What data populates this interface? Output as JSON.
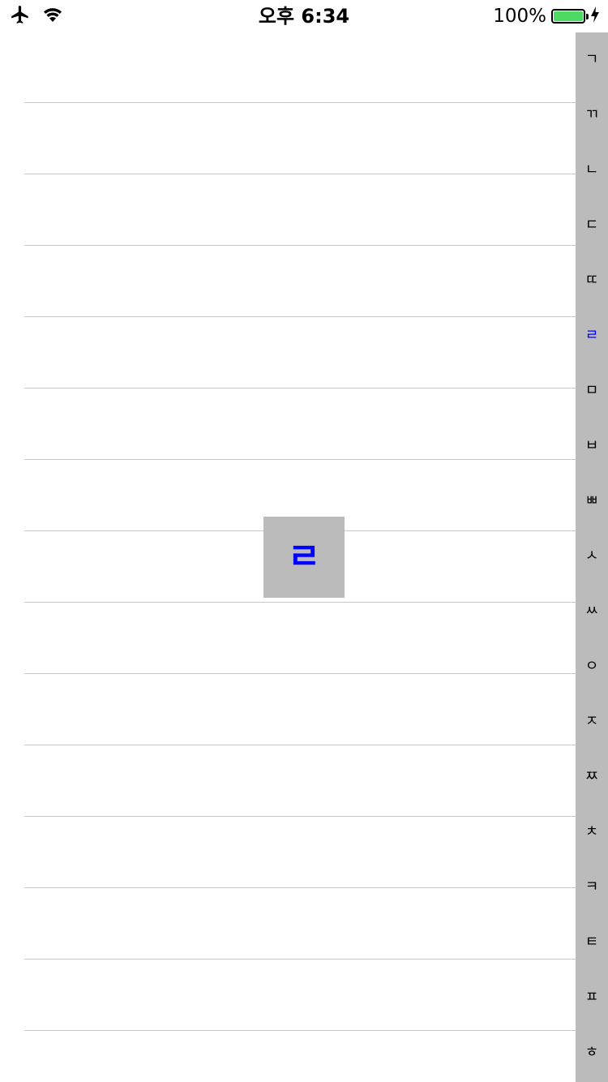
{
  "status_bar": {
    "time": "오후 6:34",
    "battery_percent": "100%",
    "battery_level": 1.0,
    "battery_color": "#4cd964",
    "icons": [
      "airplane-icon",
      "wifi-icon",
      "charging-bolt-icon"
    ]
  },
  "table": {
    "row_count": 15
  },
  "index": {
    "highlight_color": "#0000ff",
    "selected": "ㄹ",
    "letters": [
      "ㄱ",
      "ㄲ",
      "ㄴ",
      "ㄷ",
      "ㄸ",
      "ㄹ",
      "ㅁ",
      "ㅂ",
      "ㅃ",
      "ㅅ",
      "ㅆ",
      "ㅇ",
      "ㅈ",
      "ㅉ",
      "ㅊ",
      "ㅋ",
      "ㅌ",
      "ㅍ",
      "ㅎ"
    ]
  },
  "overlay": {
    "letter": "ㄹ"
  }
}
